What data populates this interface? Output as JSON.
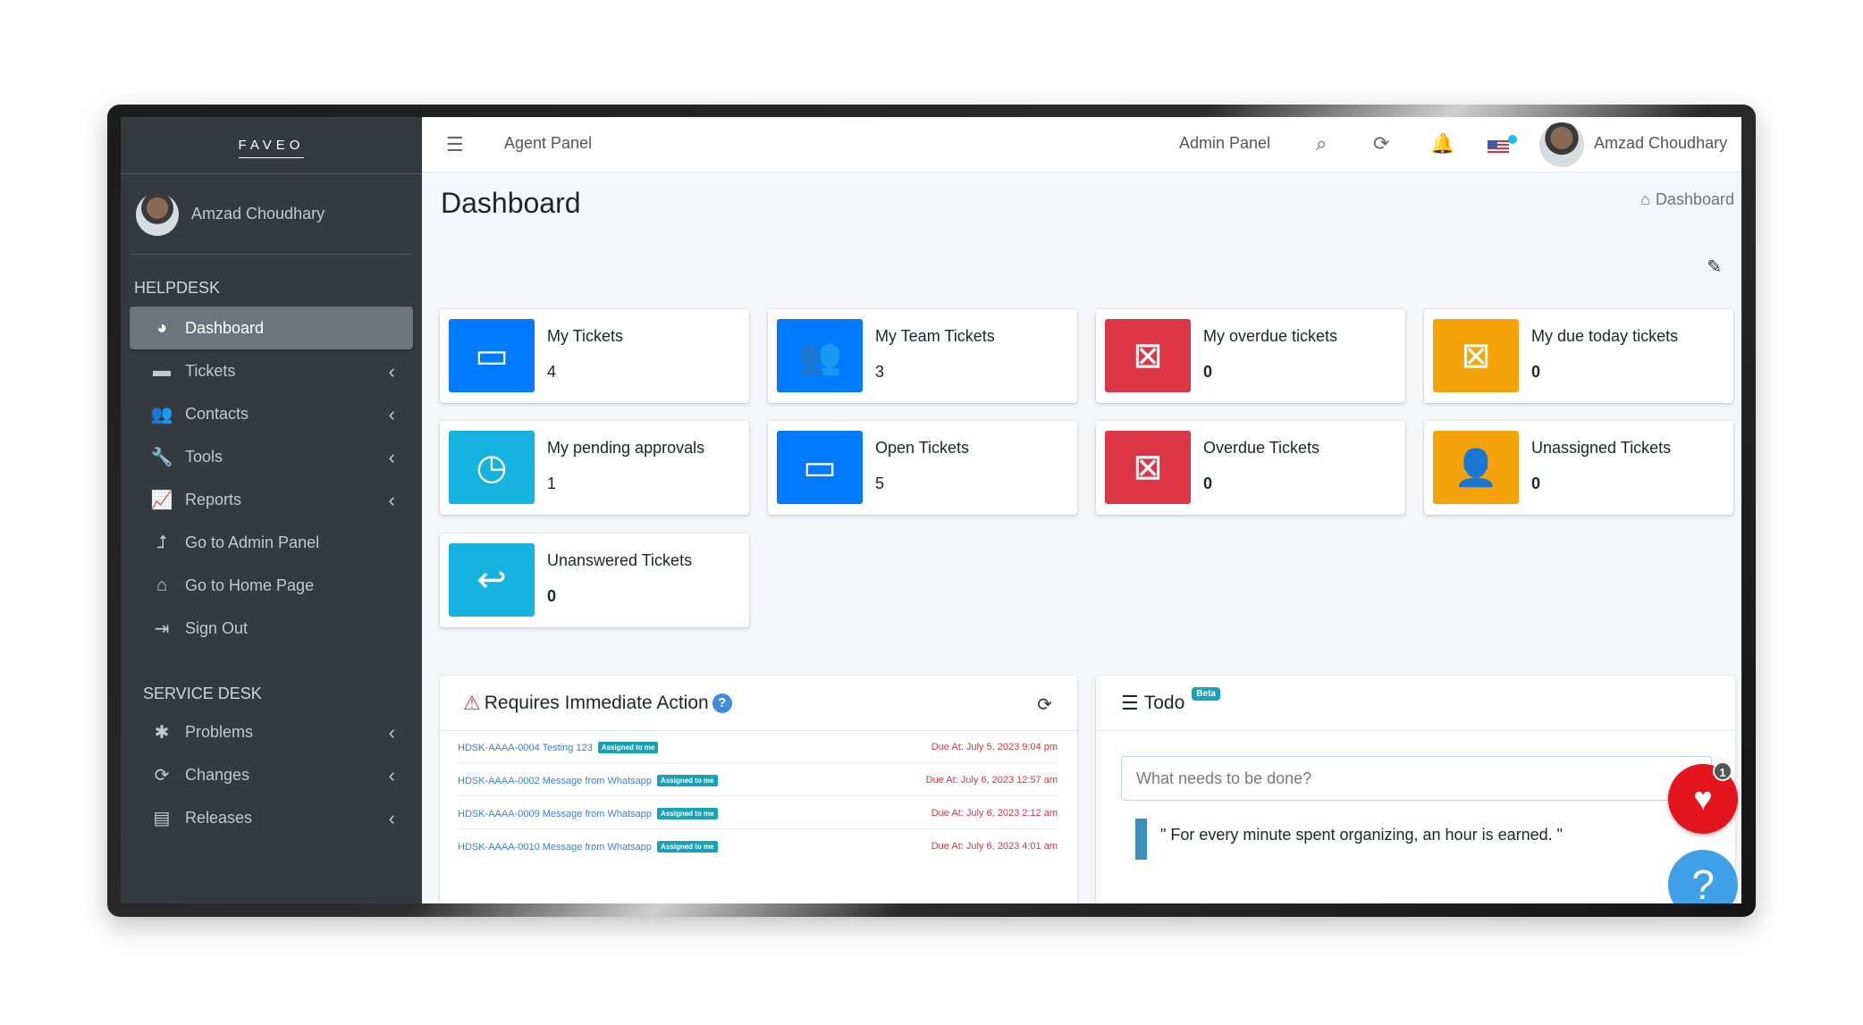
{
  "sidebar": {
    "logo": "FAVEO",
    "user_name": "Amzad Choudhary",
    "helpdesk_header": "HELPDESK",
    "service_header": "SERVICE DESK",
    "items": [
      {
        "label": "Dashboard",
        "icon": "dashboard-icon"
      },
      {
        "label": "Tickets",
        "icon": "ticket-icon"
      },
      {
        "label": "Contacts",
        "icon": "users-icon"
      },
      {
        "label": "Tools",
        "icon": "wrench-icon"
      },
      {
        "label": "Reports",
        "icon": "chart-icon"
      },
      {
        "label": "Go to Admin Panel",
        "icon": "level-up-icon"
      },
      {
        "label": "Go to Home Page",
        "icon": "home-icon"
      },
      {
        "label": "Sign Out",
        "icon": "sign-out-icon"
      }
    ],
    "service_items": [
      {
        "label": "Problems",
        "icon": "bug-icon"
      },
      {
        "label": "Changes",
        "icon": "refresh-icon"
      },
      {
        "label": "Releases",
        "icon": "release-icon"
      }
    ]
  },
  "header": {
    "agent_panel": "Agent Panel",
    "admin_panel": "Admin Panel",
    "user_name": "Amzad Choudhary"
  },
  "page": {
    "title": "Dashboard",
    "breadcrumb": "Dashboard"
  },
  "cards": [
    {
      "label": "My Tickets",
      "value": "4",
      "color": "#007bff",
      "icon": "inbox-icon"
    },
    {
      "label": "My Team Tickets",
      "value": "3",
      "color": "#007bff",
      "icon": "team-icon"
    },
    {
      "label": "My overdue tickets",
      "value": "0",
      "color": "#dc3545",
      "icon": "calendar-x-icon"
    },
    {
      "label": "My due today tickets",
      "value": "0",
      "color": "#f4a30b",
      "icon": "calendar-x-icon"
    },
    {
      "label": "My pending approvals",
      "value": "1",
      "color": "#17b3e0",
      "icon": "clock-icon"
    },
    {
      "label": "Open Tickets",
      "value": "5",
      "color": "#007bff",
      "icon": "inbox-icon"
    },
    {
      "label": "Overdue Tickets",
      "value": "0",
      "color": "#dc3545",
      "icon": "calendar-x-icon"
    },
    {
      "label": "Unassigned Tickets",
      "value": "0",
      "color": "#f4a30b",
      "icon": "user-x-icon"
    },
    {
      "label": "Unanswered Tickets",
      "value": "0",
      "color": "#17b3e0",
      "icon": "reply-icon"
    }
  ],
  "action_panel": {
    "title": "Requires Immediate Action",
    "rows": [
      {
        "ticket": "HDSK-AAAA-0004 Testing 123",
        "badge": "Assigned to me",
        "due": "Due At: July 5, 2023 9:04 pm"
      },
      {
        "ticket": "HDSK-AAAA-0002 Message from Whatsapp",
        "badge": "Assigned to me",
        "due": "Due At: July 6, 2023 12:57 am"
      },
      {
        "ticket": "HDSK-AAAA-0009 Message from Whatsapp",
        "badge": "Assigned to me",
        "due": "Due At: July 6, 2023 2:12 am"
      },
      {
        "ticket": "HDSK-AAAA-0010 Message from Whatsapp",
        "badge": "Assigned to me",
        "due": "Due At: July 6, 2023 4:01 am"
      }
    ]
  },
  "todo": {
    "title": "Todo",
    "beta": "Beta",
    "placeholder": "What needs to be done?",
    "quote": "\" For every minute spent organizing, an hour is earned. \""
  },
  "floating": {
    "heart_count": "1",
    "help": "?"
  }
}
